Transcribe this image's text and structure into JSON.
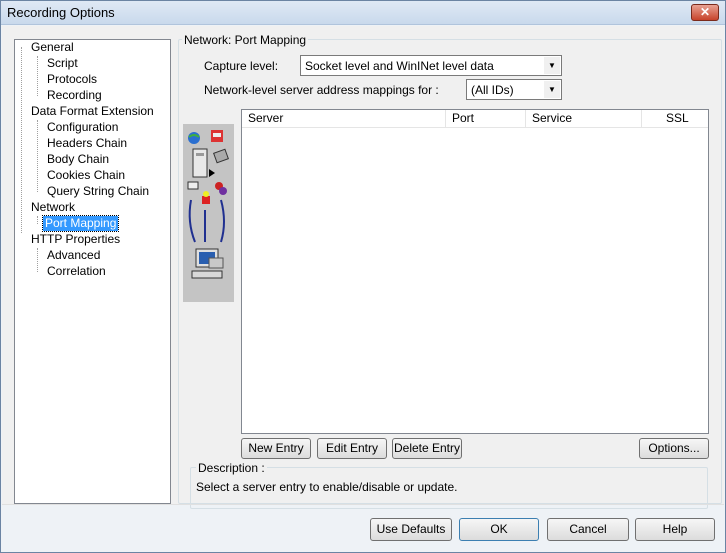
{
  "window": {
    "title": "Recording Options",
    "close_label": "✕"
  },
  "tree": {
    "items": [
      {
        "label": "General"
      },
      {
        "label": "Script"
      },
      {
        "label": "Protocols"
      },
      {
        "label": "Recording"
      },
      {
        "label": "Data Format Extension"
      },
      {
        "label": "Configuration"
      },
      {
        "label": "Headers Chain"
      },
      {
        "label": "Body Chain"
      },
      {
        "label": "Cookies Chain"
      },
      {
        "label": "Query String Chain"
      },
      {
        "label": "Network"
      },
      {
        "label": "Port Mapping"
      },
      {
        "label": "HTTP Properties"
      },
      {
        "label": "Advanced"
      },
      {
        "label": "Correlation"
      }
    ],
    "selected": "Port Mapping"
  },
  "panel": {
    "title": "Network: Port Mapping",
    "capture_label": "Capture level:",
    "capture_value": "Socket level and WinINet level data",
    "mapping_label": "Network-level server address mappings for :",
    "mapping_value": "(All IDs)"
  },
  "list": {
    "columns": [
      "Server",
      "Port",
      "Service",
      "SSL"
    ],
    "rows": []
  },
  "list_buttons": {
    "new_entry": "New Entry",
    "edit_entry": "Edit Entry",
    "delete_entry": "Delete Entry",
    "options": "Options..."
  },
  "description": {
    "title": "Description :",
    "text": "Select a server entry to enable/disable or update."
  },
  "footer": {
    "use_defaults": "Use Defaults",
    "ok": "OK",
    "cancel": "Cancel",
    "help": "Help"
  }
}
